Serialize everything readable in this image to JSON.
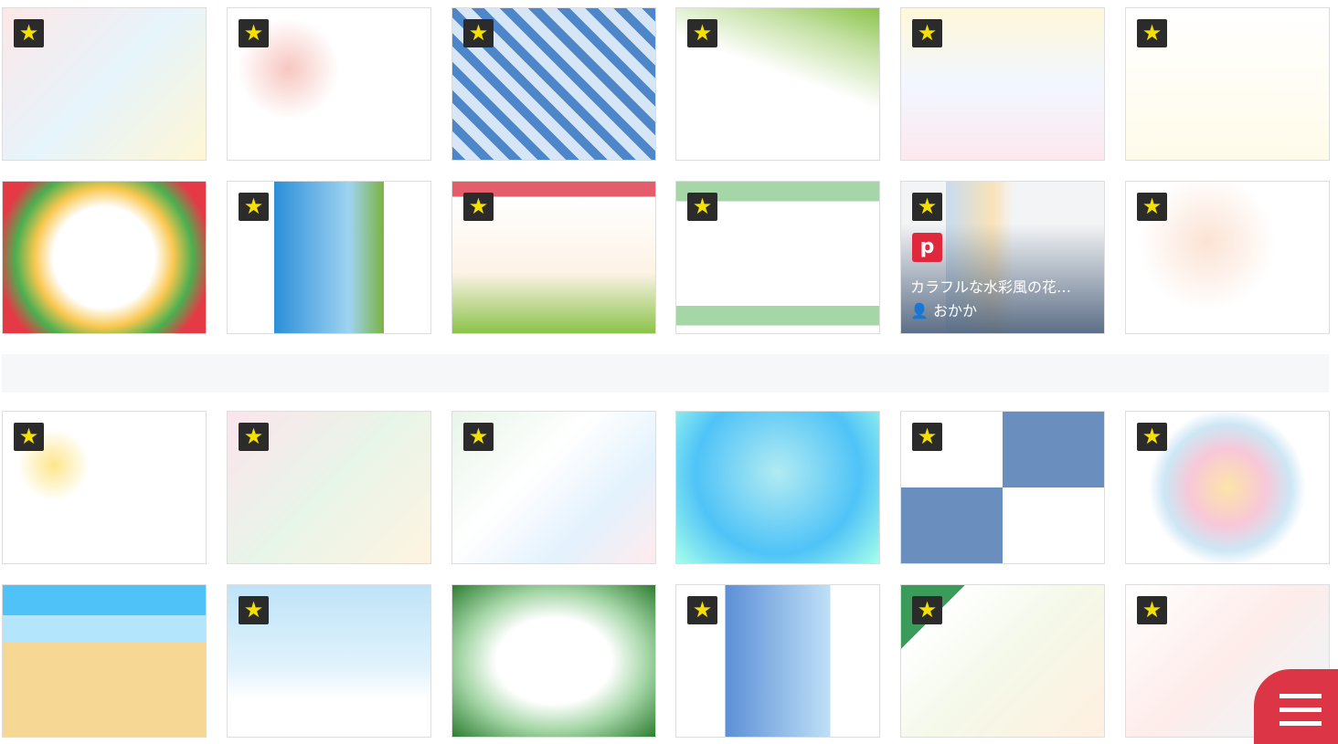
{
  "colors": {
    "star_bg": "#2b2b2b",
    "star": "#f5e000",
    "pinterest": "#e0283c",
    "menu": "#dc3545"
  },
  "icons": {
    "favorite": "star-icon",
    "pin": "pinterest-icon",
    "user": "user-icon",
    "menu": "hamburger-menu-icon"
  },
  "tiles": [
    {
      "star": true,
      "bg": "linear-gradient(135deg,#fde7e7,#e6f4fb 50%,#fff6d6)"
    },
    {
      "star": true,
      "bg": "radial-gradient(circle at 30% 40%,#f7c6c0 0,#fff 30%),radial-gradient(circle at 70% 60%,#bfe0f0 0,#fff 35%)"
    },
    {
      "star": true,
      "bg": "repeating-linear-gradient(45deg,#4d86c9 0 10px,#d7e6f6 10px 22px)"
    },
    {
      "star": true,
      "bg": "linear-gradient(200deg,#8bc34a 0,#c5e1a5 20%,#fff 45%)"
    },
    {
      "star": true,
      "bg": "linear-gradient(180deg,#fff7d9,#f2f7ff 50%,#fde8ef)"
    },
    {
      "star": true,
      "bg": "linear-gradient(180deg,#fff,#fffbea)"
    },
    {
      "star": false,
      "bg": "radial-gradient(circle at 50% 50%,#fff 0,#fff 40%,#f9c74f 55%,#4caf50 70%,#e63946 85%)"
    },
    {
      "star": true,
      "bg": "linear-gradient(90deg,#fff 0 23%,#2b8fd8 23%,#9fd3f2 60%,#7cb342 77%,#fff 77%)"
    },
    {
      "star": true,
      "bg": "linear-gradient(180deg,#e35d6a 0 10%,#fff 10%,#fdf3e6 60%,#8bc34a)"
    },
    {
      "star": true,
      "bg": "linear-gradient(180deg,#a5d6a7 0 13%,#fff 13% 82%,#a5d6a7 82% 95%,#fff 95%)"
    },
    {
      "star": true,
      "bg": "linear-gradient(90deg,#f3f4f6 0 22%,#c7dcef 22%,#f9e2b8 45%,#f3f4f6 55%)",
      "title": "カラフルな水彩風の花…",
      "author": "おかか"
    },
    {
      "star": true,
      "bg": "radial-gradient(circle at 40% 40%,#fbe3d4 0,#fff 45%),radial-gradient(circle at 70% 70%,#cde9f1 0,#fff 40%)"
    },
    {
      "star": true,
      "bg": "radial-gradient(circle at 25% 35%,#fde68a 0,#fff 20%),radial-gradient(circle at 70% 50%,#fbcfe8 0,#fff 22%)"
    },
    {
      "star": true,
      "bg": "linear-gradient(135deg,#fce4ec,#e8f5e9 50%,#fff3e0)"
    },
    {
      "star": true,
      "bg": "linear-gradient(135deg,#e8f5e9,#fff 40%,#e3f2fd 70%,#ffebee)"
    },
    {
      "star": false,
      "bg": "radial-gradient(circle at 50% 40%,#b2ebf2 0,#4fc3f7 60%,#a7ffeb)"
    },
    {
      "star": true,
      "bg": "conic-gradient(#6a8fbf 0 25%,#fff 25% 50%,#6a8fbf 50% 75%,#fff 75%)"
    },
    {
      "star": true,
      "bg": "radial-gradient(circle at 50% 50%,#fce4a8 0,#f8c8d8 30%,#cde7f5 50%,#fff 62%)"
    },
    {
      "star": false,
      "bg": "linear-gradient(180deg,#4fc3f7 0 20%,#b3e5fc 20% 38%,#f7d794 38%)"
    },
    {
      "star": true,
      "bg": "linear-gradient(180deg,#bfe3f7,#e1f3fd 55%,#fff 75%)"
    },
    {
      "star": false,
      "bg": "radial-gradient(ellipse at 50% 50%,#fff 0 40%,#a5d6a7 65%,#2e7d32 100%)"
    },
    {
      "star": true,
      "bg": "linear-gradient(90deg,#fff 0 24%,#5c8fd6 24%,#bfe0f7 76%,#fff 76%)"
    },
    {
      "star": true,
      "bg": "linear-gradient(135deg,#3b9c5a 0 18%,#fff 18%,#f4f9e9 50%,#fff0e0)"
    },
    {
      "star": true,
      "bg": "linear-gradient(135deg,#fff,#fdecea 50%,#eaf6fb)"
    }
  ]
}
